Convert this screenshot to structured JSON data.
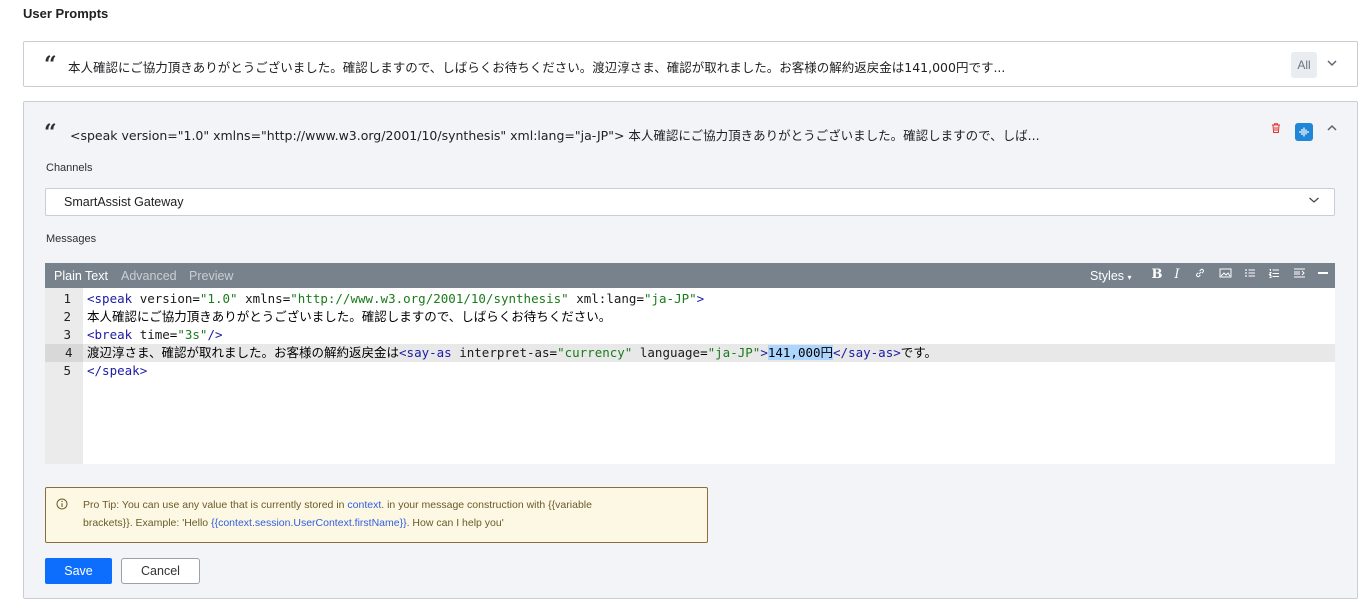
{
  "section_title": "User Prompts",
  "prompt_list": [
    {
      "quote_icon": "quote-icon",
      "text": "本人確認にご協力頂きありがとうございました。確認しますので、しばらくお待ちください。渡辺淳さま、確認が取れました。お客様の解約返戻金は141,000円です...",
      "badge": "All",
      "chevron": "chevron-down-icon"
    },
    {
      "quote_icon": "quote-icon",
      "text": "<speak version=\"1.0\" xmlns=\"http://www.w3.org/2001/10/synthesis\" xml:lang=\"ja-JP\"> 本人確認にご協力頂きありがとうございました。確認しますので、しば...",
      "delete_icon": "trash-icon",
      "voice_icon": "voice-wave-icon",
      "chevron": "chevron-up-icon"
    }
  ],
  "form": {
    "channels_label": "Channels",
    "channel_selected": "SmartAssist Gateway",
    "messages_label": "Messages"
  },
  "editor": {
    "tabs": [
      "Plain Text",
      "Advanced",
      "Preview"
    ],
    "active_tab": "Plain Text",
    "styles_label": "Styles",
    "tools": [
      "bold-icon",
      "italic-icon",
      "link-icon",
      "image-icon",
      "bullet-list-icon",
      "numbered-list-icon",
      "indent-icon",
      "horizontal-rule-icon"
    ],
    "active_line": 4,
    "selected_text": "141,000円",
    "line_numbers": [
      "1",
      "2",
      "3",
      "4",
      "5"
    ],
    "lines": [
      "<speak version=\"1.0\" xmlns=\"http://www.w3.org/2001/10/synthesis\" xml:lang=\"ja-JP\">",
      "本人確認にご協力頂きありがとうございました。確認しますので、しばらくお待ちください。",
      "<break time=\"3s\"/>",
      "渡辺淳さま、確認が取れました。お客様の解約返戻金は<say-as interpret-as=\"currency\" language=\"ja-JP\">141,000円</say-as>です。",
      "</speak>"
    ]
  },
  "tip": {
    "icon": "info-icon",
    "line1_prefix": "Pro Tip: You can use any value that is currently stored in ",
    "line1_link": "context",
    "line1_suffix": ". in your message construction with {{variable",
    "line2_prefix": "brackets}}. Example: 'Hello ",
    "line2_link": "{{context.session.UserContext.firstName}}",
    "line2_suffix": ". How can I help you'"
  },
  "buttons": {
    "save": "Save",
    "cancel": "Cancel"
  },
  "colors": {
    "primary": "#0d6efd",
    "toolbar": "#78828c",
    "tip_background": "#fdf8e4",
    "tip_border": "#8a6d3b",
    "voice_button": "#1f87d6",
    "delete": "#e03131"
  }
}
